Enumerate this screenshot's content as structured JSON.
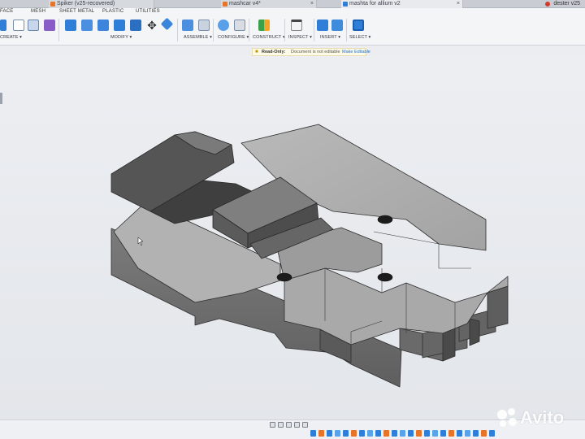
{
  "tabs": [
    {
      "label": "Spiker (v25-recovered)",
      "icon": "fusion-doc-icon",
      "color": "#e8742a"
    },
    {
      "label": "mashcar v4*",
      "icon": "fusion-doc-icon",
      "color": "#e8742a"
    },
    {
      "label": "mashta for allium v2",
      "icon": "fusion-doc-icon",
      "color": "#2f7ed8"
    }
  ],
  "user": {
    "label": "dester v25"
  },
  "workspace_tabs": [
    "FACE",
    "MESH",
    "SHEET METAL",
    "PLASTIC",
    "UTILITIES"
  ],
  "toolbar_groups": [
    "CREATE ▾",
    "MODIFY ▾",
    "ASSEMBLE ▾",
    "CONFIGURE ▾",
    "CONSTRUCT ▾",
    "INSPECT ▾",
    "INSERT ▾",
    "SELECT ▾"
  ],
  "readonly_bar": {
    "title": "Read-Only:",
    "note": "Document is not editable",
    "action": "Make Editable"
  },
  "colors": {
    "accent_blue": "#2f7ed8",
    "model_top": "#b3b3b3",
    "model_side": "#6e6e6e",
    "model_dark": "#505050",
    "readonly_bg": "#fffbe6"
  },
  "watermark": {
    "text": "Avito"
  }
}
